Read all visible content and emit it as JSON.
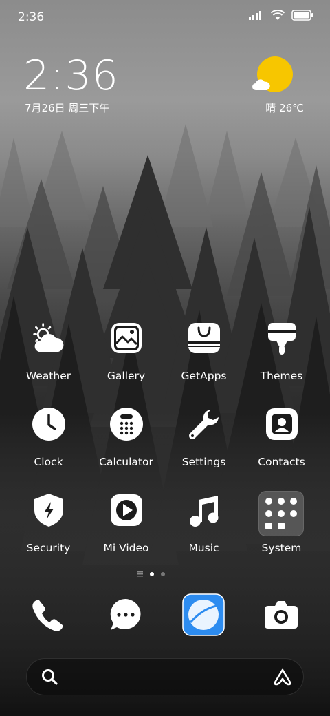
{
  "status_bar": {
    "time": "2:36",
    "icons": [
      "signal-icon",
      "wifi-icon",
      "battery-icon"
    ]
  },
  "lock_widget": {
    "time": "2:36",
    "date": "7月26日 周三下午"
  },
  "weather_widget": {
    "condition_temp": "晴 26℃",
    "sun_color": "#f7c600"
  },
  "apps": [
    {
      "label": "Weather",
      "icon": "weather-icon"
    },
    {
      "label": "Gallery",
      "icon": "gallery-icon"
    },
    {
      "label": "GetApps",
      "icon": "getapps-icon"
    },
    {
      "label": "Themes",
      "icon": "themes-icon"
    },
    {
      "label": "Clock",
      "icon": "clock-icon"
    },
    {
      "label": "Calculator",
      "icon": "calculator-icon"
    },
    {
      "label": "Settings",
      "icon": "settings-icon"
    },
    {
      "label": "Contacts",
      "icon": "contacts-icon"
    },
    {
      "label": "Security",
      "icon": "security-icon"
    },
    {
      "label": "Mi Video",
      "icon": "video-icon"
    },
    {
      "label": "Music",
      "icon": "music-icon"
    },
    {
      "label": "System",
      "icon": "system-folder-icon"
    }
  ],
  "page_indicator": {
    "pages": 2,
    "active": 1
  },
  "dock": [
    {
      "icon": "phone-icon"
    },
    {
      "icon": "messages-icon"
    },
    {
      "icon": "browser-icon",
      "color": "#2d8cf0"
    },
    {
      "icon": "camera-icon"
    }
  ],
  "search_bar": {
    "placeholder": ""
  }
}
